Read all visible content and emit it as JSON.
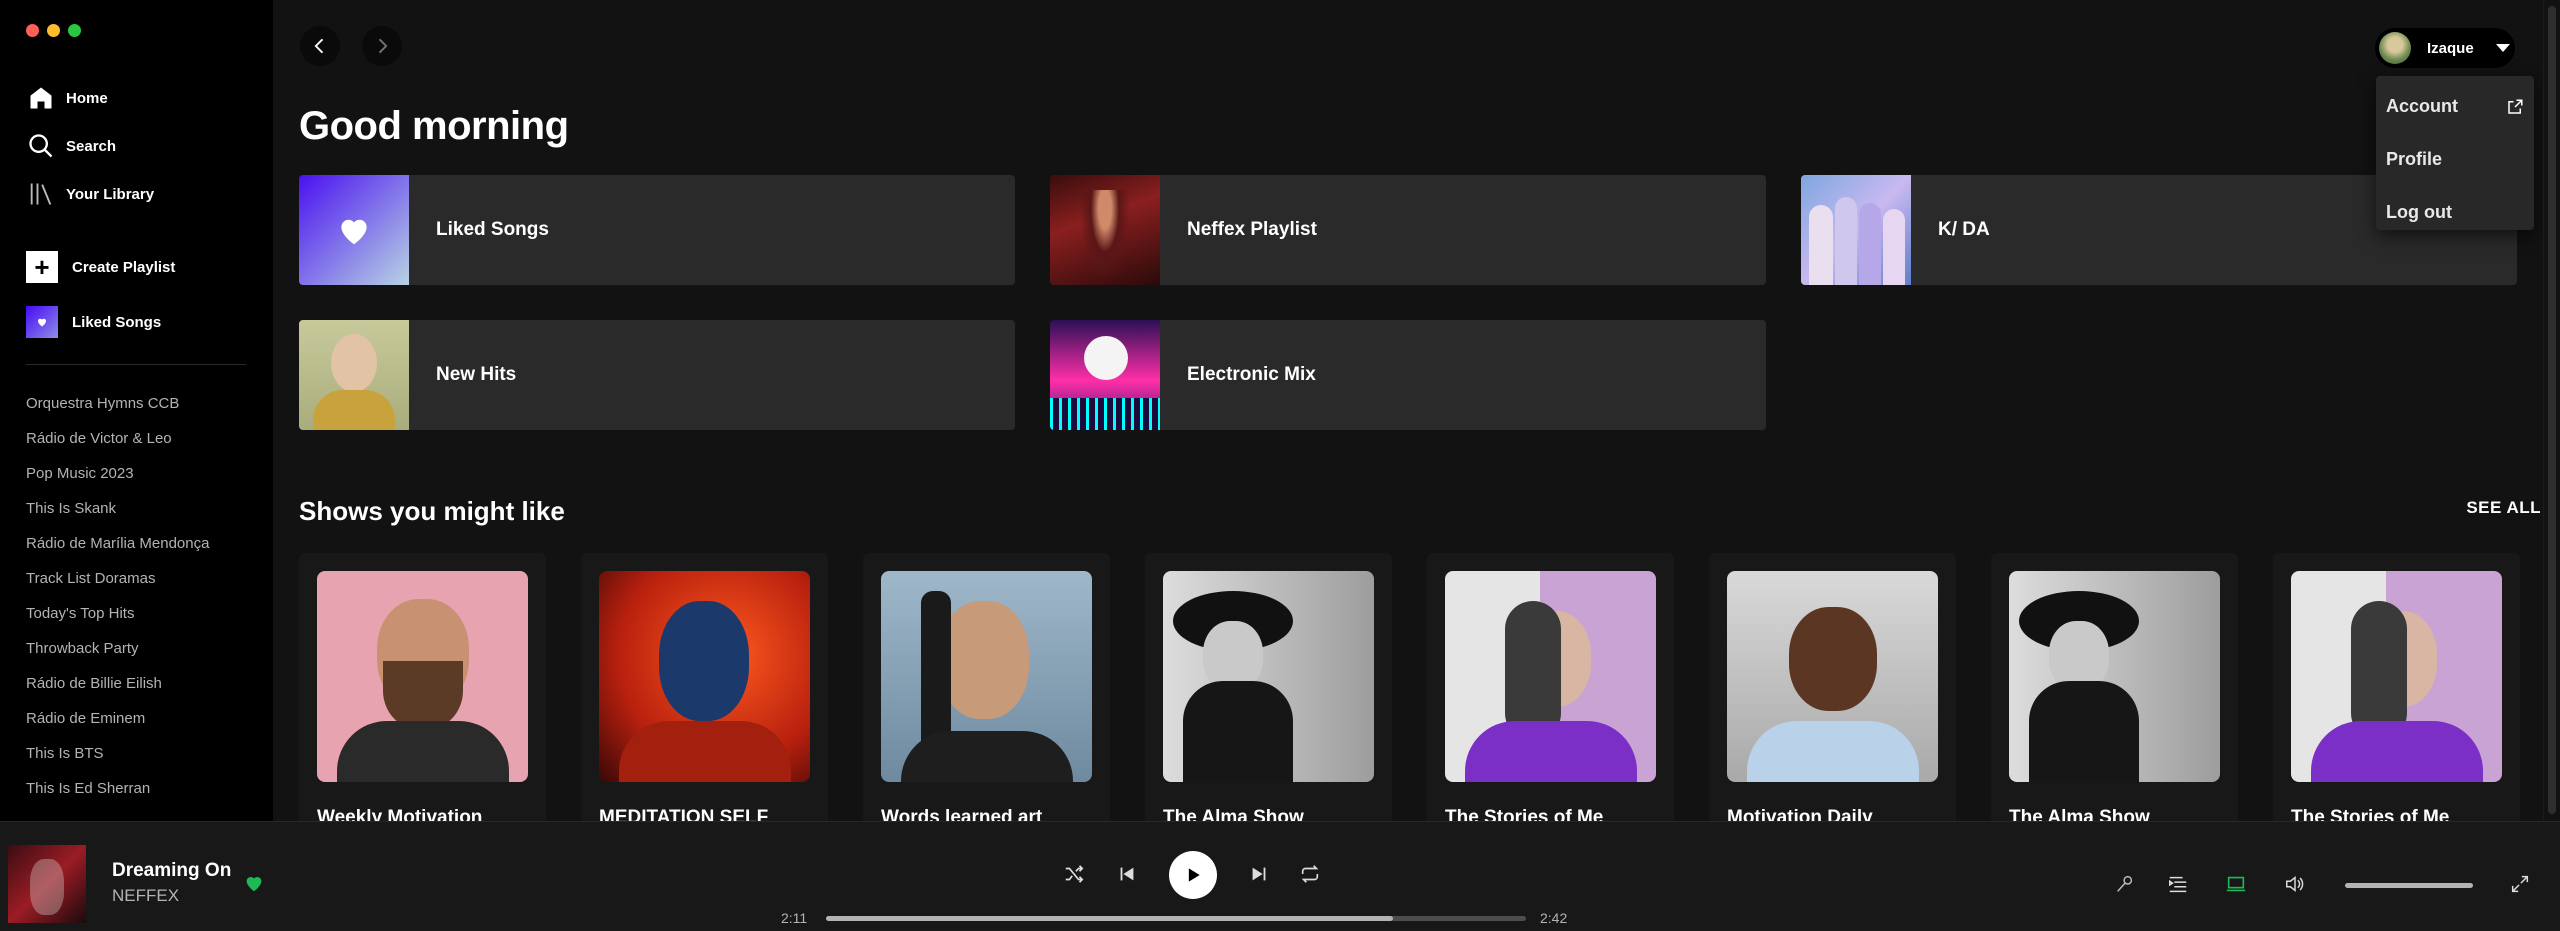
{
  "window": {
    "traffic_lights": [
      "#ff5f57",
      "#febc2e",
      "#28c840"
    ]
  },
  "sidebar": {
    "nav": [
      {
        "label": "Home",
        "icon": "home-icon"
      },
      {
        "label": "Search",
        "icon": "search-icon"
      },
      {
        "label": "Your Library",
        "icon": "library-icon"
      }
    ],
    "create_playlist": "Create Playlist",
    "liked_songs": "Liked Songs",
    "playlists": [
      "Orquestra Hymns CCB",
      "Rádio de Victor & Leo",
      "Pop Music 2023",
      "This Is Skank",
      "Rádio de Marília Mendonça",
      "Track List Doramas",
      "Today's Top Hits",
      "Throwback Party",
      "Rádio de Billie Eilish",
      "Rádio de Eminem",
      "This Is BTS",
      "This Is Ed Sherran"
    ]
  },
  "main": {
    "greeting": "Good morning",
    "quick_picks": [
      {
        "title": "Liked Songs"
      },
      {
        "title": "Neffex Playlist"
      },
      {
        "title": "K/ DA"
      },
      {
        "title": "New Hits"
      },
      {
        "title": "Electronic Mix"
      }
    ],
    "shows_section": {
      "title": "Shows you might like",
      "see_all": "SEE ALL",
      "cards": [
        {
          "title": "Weekly Motivation"
        },
        {
          "title": "MEDITATION SELF"
        },
        {
          "title": "Words learned art"
        },
        {
          "title": "The Alma Show"
        },
        {
          "title": "The Stories of Me"
        },
        {
          "title": "Motivation Daily"
        },
        {
          "title": "The Alma Show"
        },
        {
          "title": "The Stories of Me"
        }
      ]
    }
  },
  "user_menu": {
    "name": "Izaque",
    "items": [
      {
        "label": "Account",
        "icon": "external-link-icon"
      },
      {
        "label": "Profile"
      },
      {
        "label": "Log out"
      }
    ]
  },
  "player": {
    "track_title": "Dreaming On",
    "artist": "NEFFEX",
    "liked": true,
    "elapsed": "2:11",
    "duration": "2:42",
    "progress_fraction": 0.81,
    "volume_fraction": 1.0,
    "accent_color": "#1db954"
  }
}
